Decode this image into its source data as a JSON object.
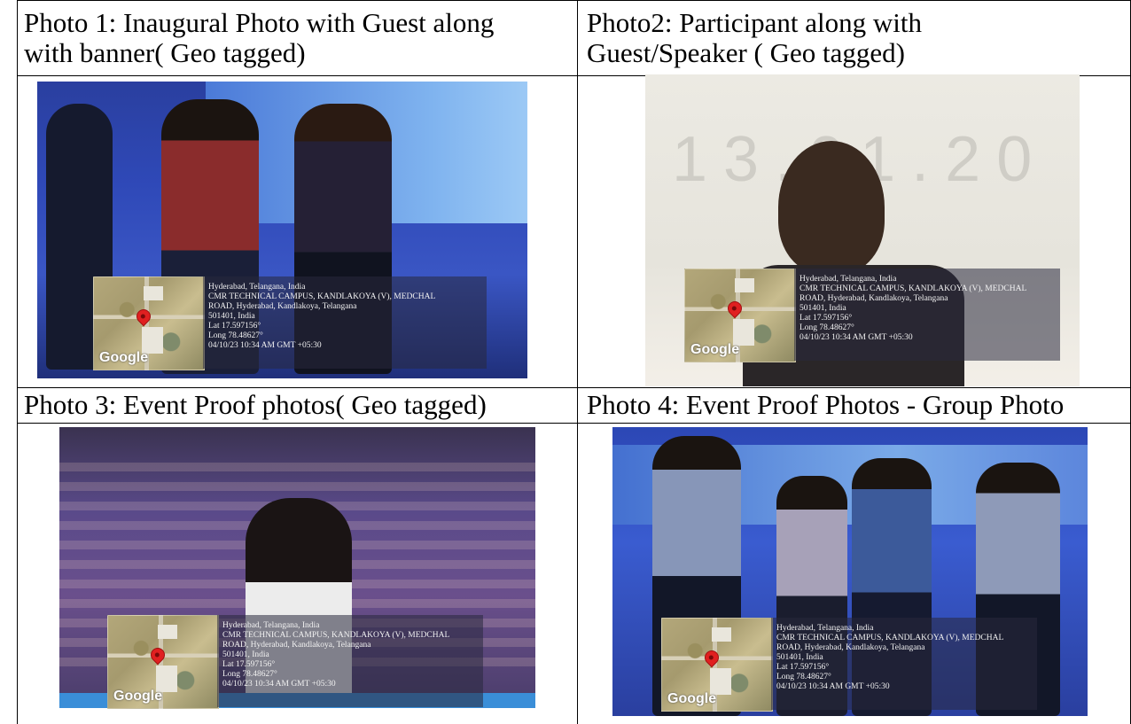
{
  "captions": {
    "photo1": [
      "Photo 1: Inaugural Photo with Guest along",
      "with banner( Geo tagged)"
    ],
    "photo2": [
      "Photo2: Participant along with",
      "Guest/Speaker ( Geo tagged)"
    ],
    "photo3": [
      "Photo 3: Event Proof photos( Geo tagged)"
    ],
    "photo4": [
      "Photo 4: Event Proof Photos - Group Photo"
    ]
  },
  "geotag": {
    "map_logo": "Google",
    "line1": "Hyderabad, Telangana, India",
    "line2": "CMR TECHNICAL CAMPUS, KANDLAKOYA (V), MEDCHAL",
    "line3": "ROAD, Hyderabad, Kandlakoya, Telangana",
    "line4": "501401, India",
    "line5": "Lat 17.597156°",
    "line6": "Long 78.48627°",
    "line7": "04/10/23 10:34 AM GMT +05:30"
  },
  "banner_text": "13.01.20",
  "colors": {
    "stage_blue": "#2f49b8",
    "stage_light": "#5f8fe0",
    "auditorium": "#5a4a8a",
    "banner_bg": "#e8e6e0"
  }
}
